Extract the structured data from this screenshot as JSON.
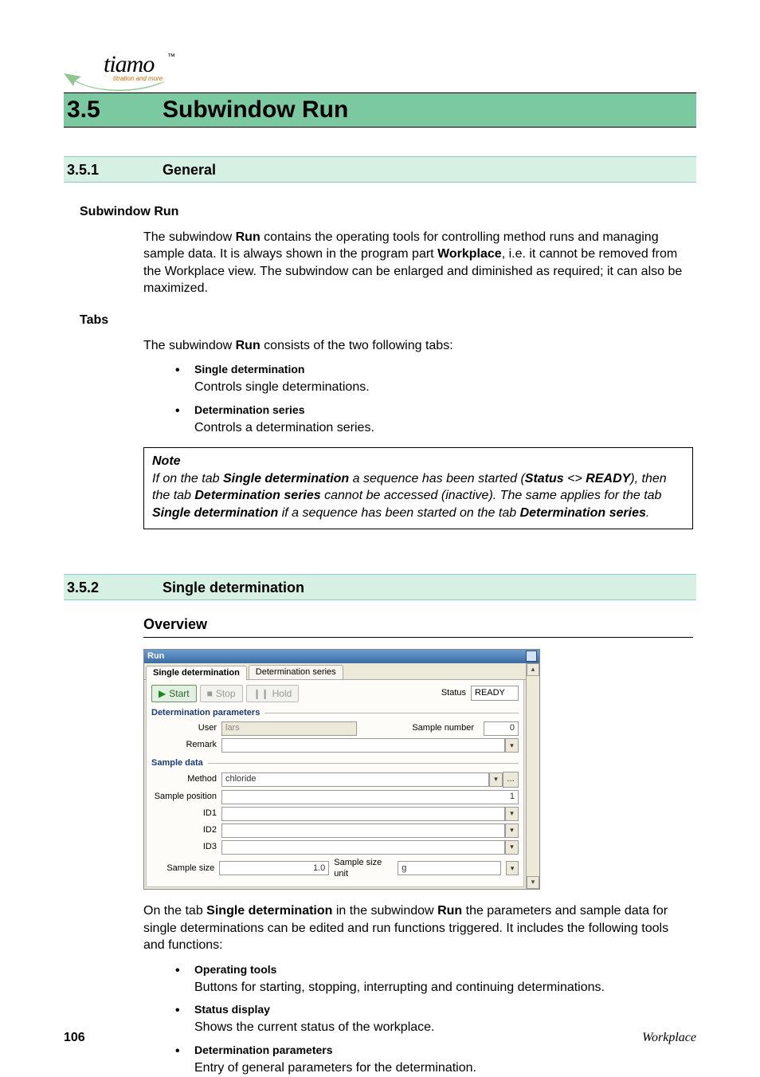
{
  "logo": {
    "text": "tiamo",
    "tm": "™",
    "sub": "titration and more"
  },
  "chapter": {
    "num": "3.5",
    "title": "Subwindow Run"
  },
  "section1": {
    "num": "3.5.1",
    "title": "General",
    "h3a": "Subwindow Run",
    "p1a": "The subwindow ",
    "p1b": "Run",
    "p1c": " contains the operating tools for controlling method runs and managing sample data. It is always shown in the program part ",
    "p1d": "Workplace",
    "p1e": ", i.e. it cannot be removed from the Workplace view. The subwindow can be enlarged and diminished as required; it can also be maximized.",
    "h3b": "Tabs",
    "p2a": "The subwindow ",
    "p2b": "Run",
    "p2c": " consists of the two following tabs:",
    "bullets": [
      {
        "title": "Single determination",
        "desc": "Controls single determinations."
      },
      {
        "title": "Determination series",
        "desc": "Controls a determination series."
      }
    ],
    "note": {
      "label": "Note",
      "t1": "If on the tab ",
      "b1": "Single determination",
      "t2": " a sequence has been started (",
      "b2": "Status",
      "sym": " <> ",
      "b3": "REA­DY",
      "t3": "), then the tab ",
      "b4": "Determination series",
      "t4": " cannot be accessed (inactive). The same applies for the tab ",
      "b5": "Single determination",
      "t5": " if a sequence has been started on the tab ",
      "b6": "Determination series",
      "t6": "."
    }
  },
  "section2": {
    "num": "3.5.2",
    "title": "Single determination",
    "overview": "Overview",
    "p1a": "On the tab ",
    "p1b": "Single determination",
    "p1c": " in the subwindow ",
    "p1d": "Run",
    "p1e": " the parameters and sample data for single determinations can be edited and run functions triggered. It includes the following tools and functions:",
    "bullets": [
      {
        "title": "Operating tools",
        "desc": "Buttons for starting, stopping, interrupting and continuing determina­tions."
      },
      {
        "title": "Status display",
        "desc": "Shows the current status of the workplace."
      },
      {
        "title": "Determination parameters",
        "desc": "Entry of general parameters for the determination."
      }
    ]
  },
  "shot": {
    "titlebar": "Run",
    "tabActive": "Single determination",
    "tabOther": "Determination series",
    "start": "Start",
    "stop": "Stop",
    "hold": "Hold",
    "statusLabel": "Status",
    "statusValue": "READY",
    "groupDP": "Determination parameters",
    "userLbl": "User",
    "userVal": "lars",
    "sampleNumLbl": "Sample number",
    "sampleNumVal": "0",
    "remarkLbl": "Remark",
    "groupSD": "Sample data",
    "methodLbl": "Method",
    "methodVal": "chloride",
    "samplePosLbl": "Sample position",
    "samplePosVal": "1",
    "id1Lbl": "ID1",
    "id2Lbl": "ID2",
    "id3Lbl": "ID3",
    "sampleSizeLbl": "Sample size",
    "sampleSizeVal": "1.0",
    "sampleSizeUnitLbl": "Sample size unit",
    "sampleSizeUnitVal": "g"
  },
  "footer": {
    "page": "106",
    "right": "Workplace"
  }
}
